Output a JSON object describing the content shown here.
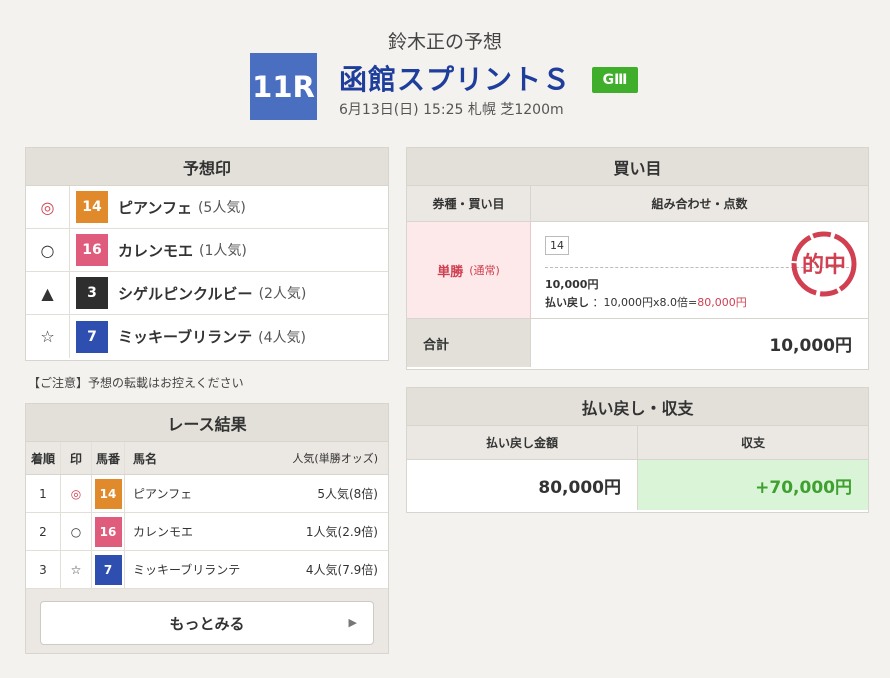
{
  "header": {
    "title": "鈴木正の予想",
    "race_no": "11R",
    "race_name": "函館スプリントＳ",
    "grade": "GⅢ",
    "race_info": "6月13日(日) 15:25 札幌 芝1200m"
  },
  "yoso": {
    "title": "予想印",
    "rows": [
      {
        "mark": "◎",
        "num": "14",
        "name": "ピアンフェ",
        "pop": "(5人気)",
        "color": "#e08a2c"
      },
      {
        "mark": "○",
        "num": "16",
        "name": "カレンモエ",
        "pop": "(1人気)",
        "color": "#e05c7c"
      },
      {
        "mark": "▲",
        "num": "3",
        "name": "シゲルピンクルビー",
        "pop": "(2人気)",
        "color": "#2e2e2e"
      },
      {
        "mark": "☆",
        "num": "7",
        "name": "ミッキーブリランテ",
        "pop": "(4人気)",
        "color": "#2f4fb0"
      }
    ]
  },
  "notice": "【ご注意】予想の転載はお控えください",
  "result": {
    "title": "レース結果",
    "cols": {
      "chaku": "着順",
      "mark": "印",
      "umaban": "馬番",
      "name": "馬名",
      "pop": "人気(単勝オッズ)"
    },
    "rows": [
      {
        "chaku": "1",
        "mark": "◎",
        "num": "14",
        "name": "ピアンフェ",
        "pop": "5人気(8倍)",
        "color": "#e08a2c"
      },
      {
        "chaku": "2",
        "mark": "○",
        "num": "16",
        "name": "カレンモエ",
        "pop": "1人気(2.9倍)",
        "color": "#e05c7c"
      },
      {
        "chaku": "3",
        "mark": "☆",
        "num": "7",
        "name": "ミッキーブリランテ",
        "pop": "4人気(7.9倍)",
        "color": "#2f4fb0"
      }
    ],
    "more": "もっとみる"
  },
  "kaime": {
    "title": "買い目",
    "col_type": "券種・買い目",
    "col_combo": "組み合わせ・点数",
    "type": "単勝",
    "subtype": "(通常)",
    "combo": "14",
    "amount": "10,000円",
    "payout_label": "払い戻し",
    "payout_calc": "：10,000円x8.0倍=",
    "payout_value": "80,000円",
    "stamp": "的中",
    "total_label": "合計",
    "total_value": "10,000円"
  },
  "payout": {
    "title": "払い戻し・収支",
    "col_amount": "払い戻し金額",
    "col_balance": "収支",
    "amount": "80,000円",
    "balance": "+70,000円"
  }
}
